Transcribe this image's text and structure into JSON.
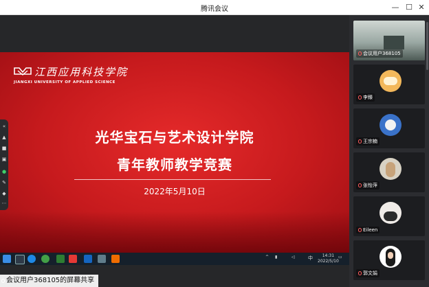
{
  "window": {
    "title": "腾讯会议"
  },
  "slide": {
    "school_cn": "江西应用科技学院",
    "school_en": "JIANGXI UNIVERSITY OF APPLIED SCIENCE",
    "title_line1": "光华宝石与艺术设计学院",
    "title_line2": "青年教师教学竞赛",
    "date": "2022年5月10日"
  },
  "taskbar": {
    "time": "14:31",
    "date": "2022/5/10",
    "ime": "中"
  },
  "share_label": "会议用户368105的屏幕共享",
  "participants": [
    {
      "name": "会议用户368105"
    },
    {
      "name": "李臻"
    },
    {
      "name": "王宗楠"
    },
    {
      "name": "张怡萍"
    },
    {
      "name": "Eileen"
    },
    {
      "name": "郭文娟"
    }
  ],
  "colors": {
    "accent_red": "#c61a1d",
    "panel_bg": "#2b2c30",
    "taskbar_bg": "#15202b"
  }
}
